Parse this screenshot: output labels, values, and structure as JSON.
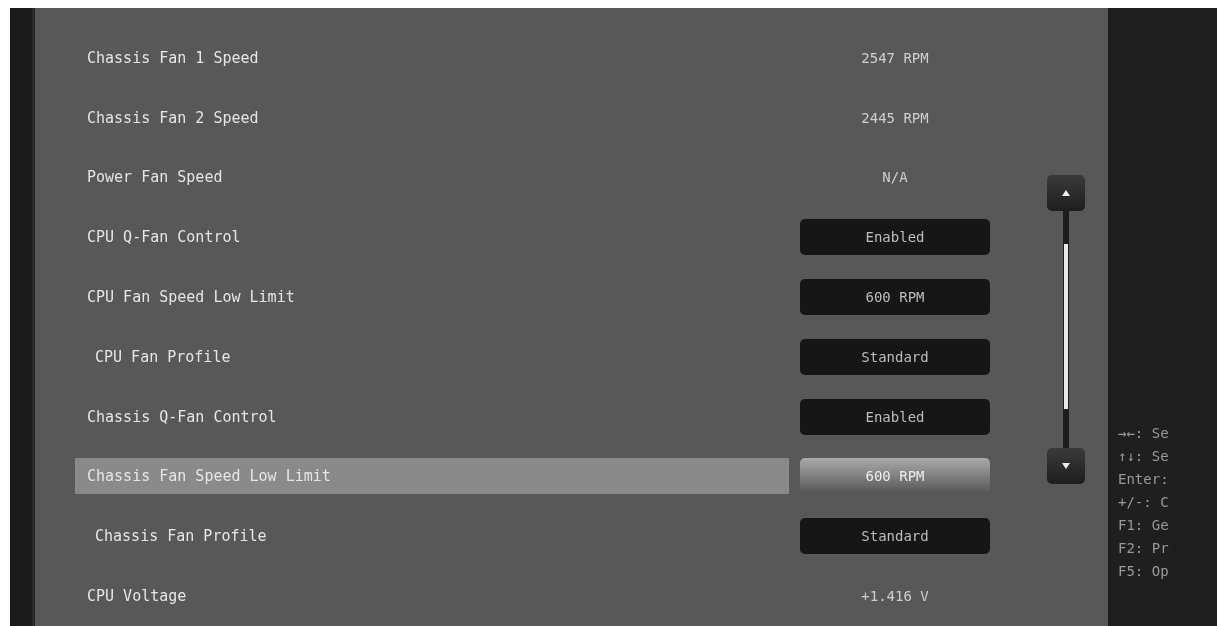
{
  "settings": [
    {
      "label": "Chassis Fan 1 Speed",
      "kind": "readout",
      "value": "2547 RPM",
      "selected": false
    },
    {
      "label": "Chassis Fan 2 Speed",
      "kind": "readout",
      "value": "2445 RPM",
      "selected": false
    },
    {
      "label": "Power Fan Speed",
      "kind": "readout",
      "value": "N/A",
      "selected": false
    },
    {
      "label": "CPU Q-Fan Control",
      "kind": "option",
      "value": "Enabled",
      "selected": false
    },
    {
      "label": "CPU Fan Speed Low Limit",
      "kind": "option",
      "value": "600 RPM",
      "selected": false,
      "children": [
        {
          "label": "CPU Fan Profile",
          "kind": "option",
          "value": "Standard",
          "selected": false
        }
      ]
    },
    {
      "label": "Chassis Q-Fan Control",
      "kind": "option",
      "value": "Enabled",
      "selected": false
    },
    {
      "label": "Chassis Fan Speed Low Limit",
      "kind": "option",
      "value": "600 RPM",
      "selected": true,
      "children": [
        {
          "label": "Chassis Fan Profile",
          "kind": "option",
          "value": "Standard",
          "selected": false
        }
      ]
    },
    {
      "label": "CPU Voltage",
      "kind": "readout",
      "value": "+1.416 V",
      "selected": false
    }
  ],
  "help_keys": [
    "→←: Se",
    "↑↓: Se",
    "Enter:",
    "+/-: C",
    "F1: Ge",
    "F2: Pr",
    "F5: Op"
  ]
}
